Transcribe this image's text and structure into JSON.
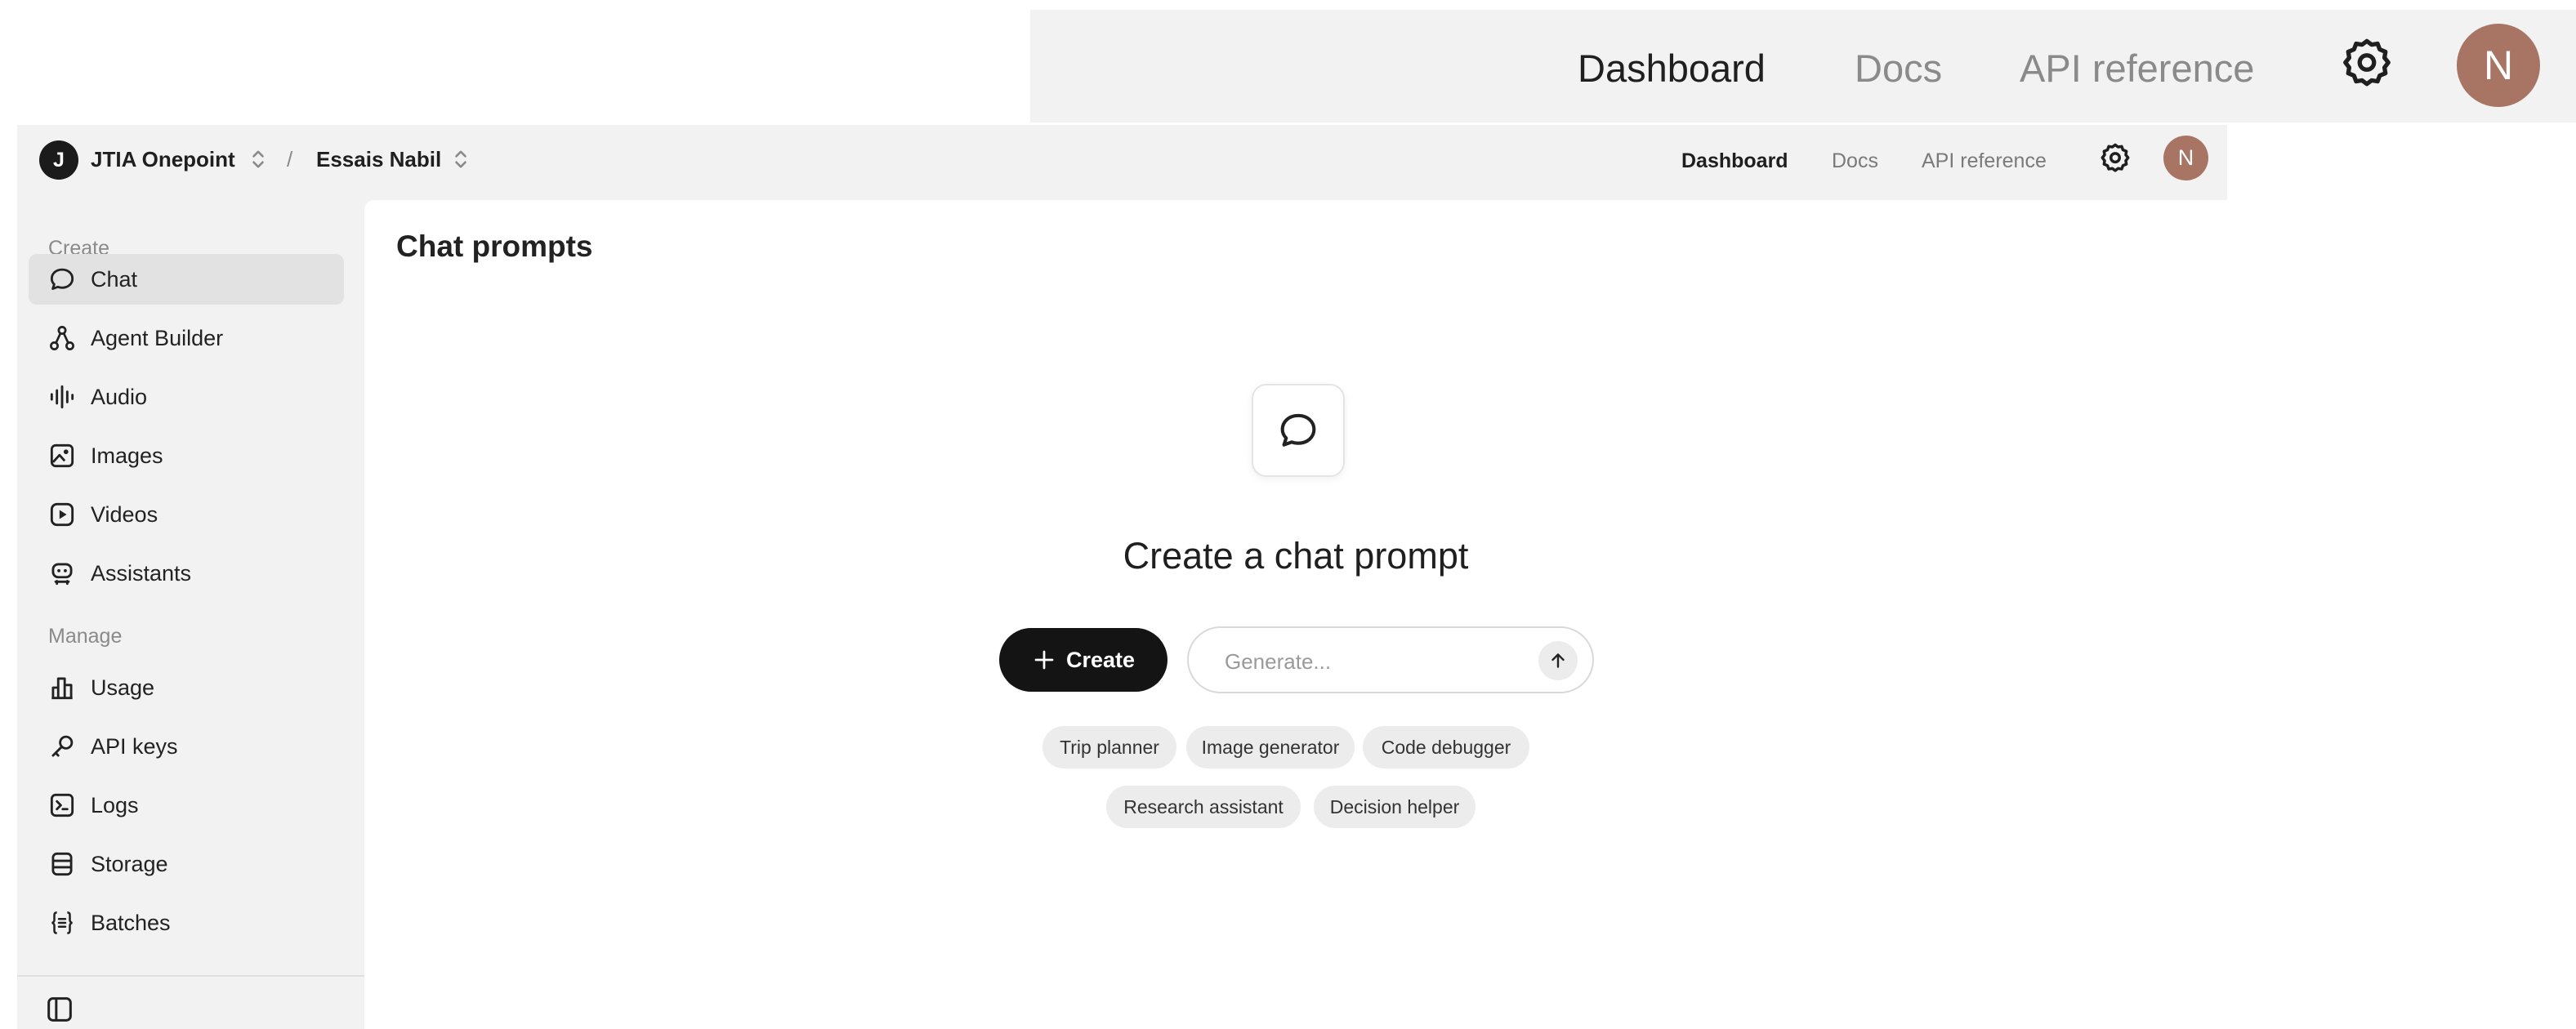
{
  "zoom_nav": {
    "links": [
      "Dashboard",
      "Docs",
      "API reference"
    ],
    "avatar_initial": "N"
  },
  "header": {
    "org_initial": "J",
    "org_name": "JTIA Onepoint",
    "separator": "/",
    "project_name": "Essais Nabil",
    "nav_links": [
      "Dashboard",
      "Docs",
      "API reference"
    ],
    "active_link": "Dashboard",
    "avatar_initial": "N",
    "settings_icon": "gear-icon"
  },
  "sidebar": {
    "create_label": "Create",
    "create_items": [
      {
        "label": "Chat",
        "icon": "chat-bubble-icon",
        "active": true
      },
      {
        "label": "Agent Builder",
        "icon": "agent-nodes-icon"
      },
      {
        "label": "Audio",
        "icon": "audio-waveform-icon"
      },
      {
        "label": "Images",
        "icon": "image-icon"
      },
      {
        "label": "Videos",
        "icon": "play-icon"
      },
      {
        "label": "Assistants",
        "icon": "robot-icon"
      }
    ],
    "manage_label": "Manage",
    "manage_items": [
      {
        "label": "Usage",
        "icon": "usage-chart-icon"
      },
      {
        "label": "API keys",
        "icon": "key-icon"
      },
      {
        "label": "Logs",
        "icon": "terminal-icon"
      },
      {
        "label": "Storage",
        "icon": "database-icon"
      },
      {
        "label": "Batches",
        "icon": "batch-braces-icon"
      }
    ],
    "collapse_icon": "sidebar-panel-icon"
  },
  "main": {
    "title": "Chat prompts",
    "empty_state": {
      "icon": "chat-bubble-icon",
      "heading": "Create a chat prompt",
      "create_label": "Create",
      "generate_placeholder": "Generate...",
      "suggestions": [
        "Trip planner",
        "Image generator",
        "Code debugger",
        "Research assistant",
        "Decision helper"
      ]
    }
  },
  "colors": {
    "accent_dark": "#141414",
    "avatar": "#a87565",
    "sidebar_bg": "#f2f2f2",
    "active_item_bg": "#e2e2e2",
    "chip_bg": "#ececec"
  }
}
